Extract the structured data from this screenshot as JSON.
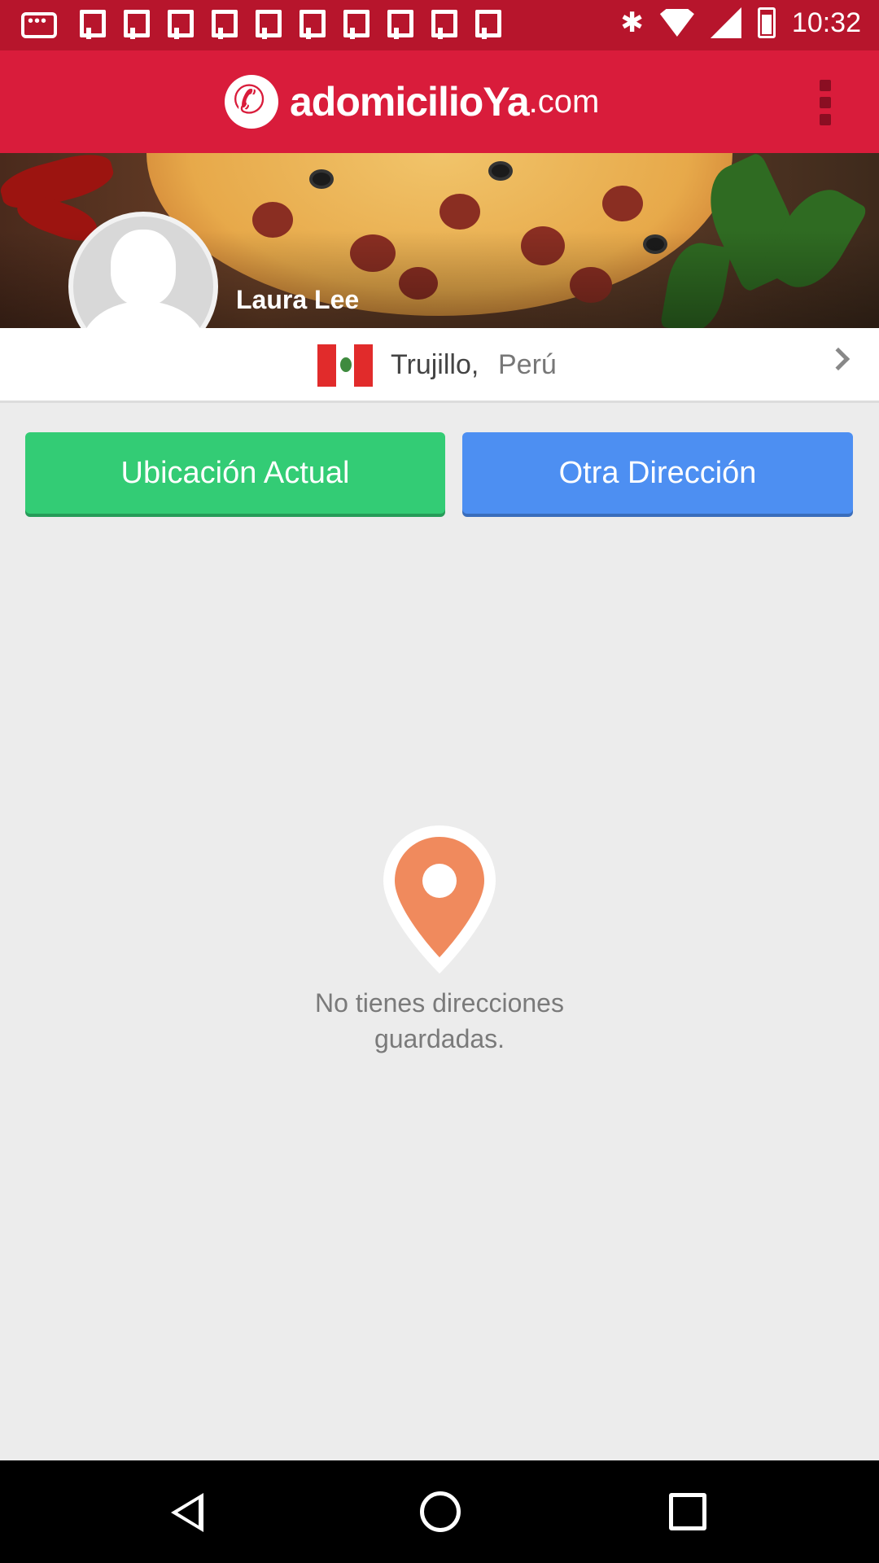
{
  "status_bar": {
    "time": "10:32",
    "icons": [
      "message-icon",
      "flipboard-icon",
      "bluetooth-icon",
      "wifi-icon",
      "signal-icon",
      "battery-icon"
    ]
  },
  "app_bar": {
    "logo_main": "adomicilioYa",
    "logo_domain": ".com",
    "brand_color": "#d91c3b"
  },
  "profile": {
    "name": "Laura Lee"
  },
  "location": {
    "city": "Trujillo,",
    "country": "Perú"
  },
  "actions": {
    "current_location_label": "Ubicación Actual",
    "other_address_label": "Otra Dirección",
    "current_location_color": "#33cc75",
    "other_address_color": "#4d8ff2"
  },
  "empty_state": {
    "line1": "No tienes direcciones",
    "line2": "guardadas.",
    "pin_color": "#f08a5d"
  }
}
